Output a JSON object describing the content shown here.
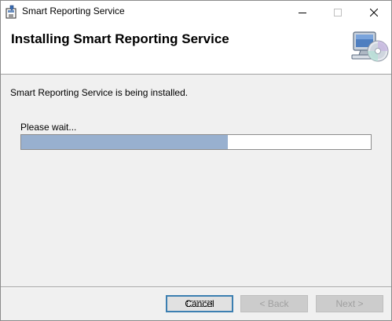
{
  "window": {
    "title": "Smart Reporting Service",
    "icon": "installer-icon",
    "controls": [
      "minimize-icon",
      "maximize-icon",
      "close-icon"
    ]
  },
  "banner": {
    "title": "Installing Smart Reporting Service",
    "icon": "computer-cd-icon"
  },
  "body": {
    "status": "Smart Reporting Service is being installed.",
    "wait_label": "Please wait...",
    "progress_fraction": 0.59
  },
  "buttons": {
    "cancel": "Cancel",
    "back": "< Back",
    "next": "Next >"
  },
  "colors": {
    "progress_fill": "#98b0cf",
    "default_button_border": "#3c7fb1"
  }
}
